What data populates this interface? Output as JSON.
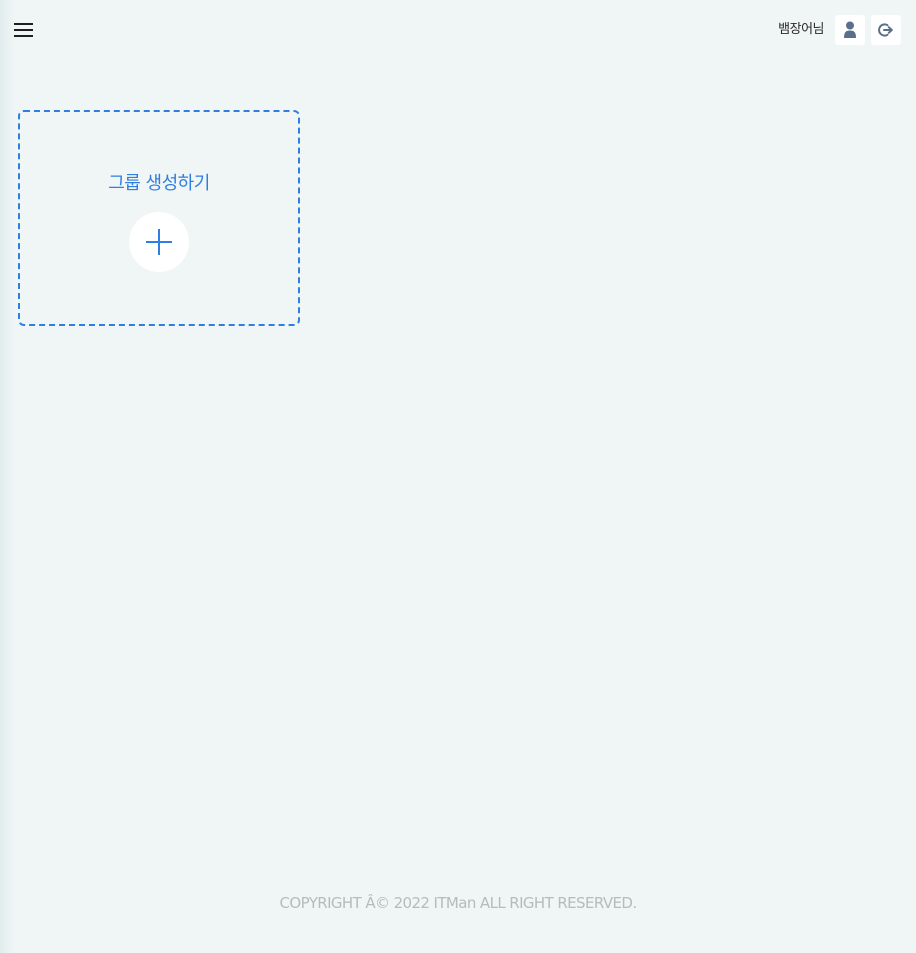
{
  "header": {
    "menu_icon": "hamburger-menu-icon",
    "user_name": "뱀장어님",
    "profile_icon": "user-icon",
    "logout_icon": "sign-out-icon"
  },
  "main": {
    "create_group": {
      "label": "그룹 생성하기",
      "icon": "plus-icon"
    }
  },
  "footer": {
    "copyright": "COPYRIGHT Â© 2022 ITMan ALL RIGHT RESERVED."
  },
  "colors": {
    "background": "#f0f5f5",
    "accent": "#2f7ee0",
    "icon": "#5a6f8c",
    "footer_text": "#b4bcbc"
  }
}
